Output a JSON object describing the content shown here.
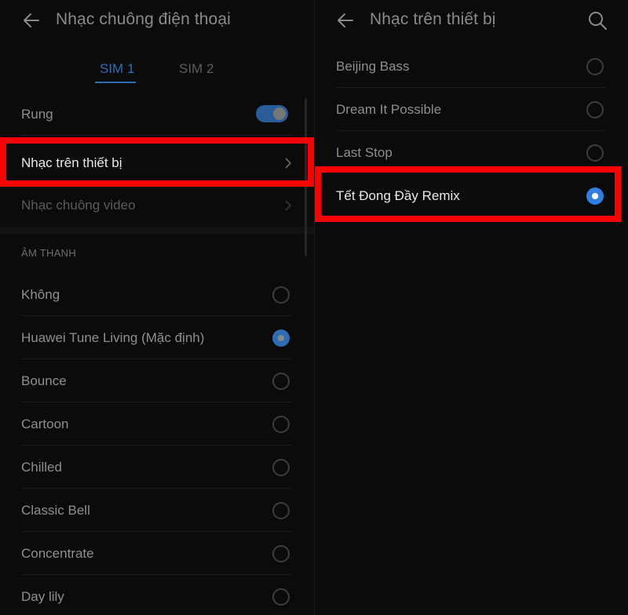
{
  "left": {
    "header": {
      "title": "Nhạc chuông điện thoại"
    },
    "tabs": [
      {
        "label": "SIM 1",
        "active": true
      },
      {
        "label": "SIM 2",
        "active": false
      }
    ],
    "vibrate": {
      "label": "Rung",
      "on": true
    },
    "device_music": {
      "label": "Nhạc trên thiết bị"
    },
    "video_ringtone": {
      "label": "Nhạc chuông video"
    },
    "section_header": "ÂM THANH",
    "sounds": [
      {
        "label": "Không",
        "selected": false
      },
      {
        "label": "Huawei Tune Living (Mặc định)",
        "selected": true
      },
      {
        "label": "Bounce",
        "selected": false
      },
      {
        "label": "Cartoon",
        "selected": false
      },
      {
        "label": "Chilled",
        "selected": false
      },
      {
        "label": "Classic Bell",
        "selected": false
      },
      {
        "label": "Concentrate",
        "selected": false
      },
      {
        "label": "Day lily",
        "selected": false
      }
    ]
  },
  "right": {
    "header": {
      "title": "Nhạc trên thiết bị"
    },
    "songs": [
      {
        "label": "Beijing Bass",
        "selected": false
      },
      {
        "label": "Dream It Possible",
        "selected": false
      },
      {
        "label": "Last Stop",
        "selected": false
      },
      {
        "label": "Tết Đong Đầy Remix",
        "selected": true
      }
    ]
  },
  "colors": {
    "accent": "#2e6db4",
    "selected_radio": "#2f7fe3",
    "highlight": "#ff0000",
    "background": "#0b0b0b"
  },
  "icons": [
    "back-arrow-icon",
    "search-icon",
    "chevron-right-icon"
  ]
}
